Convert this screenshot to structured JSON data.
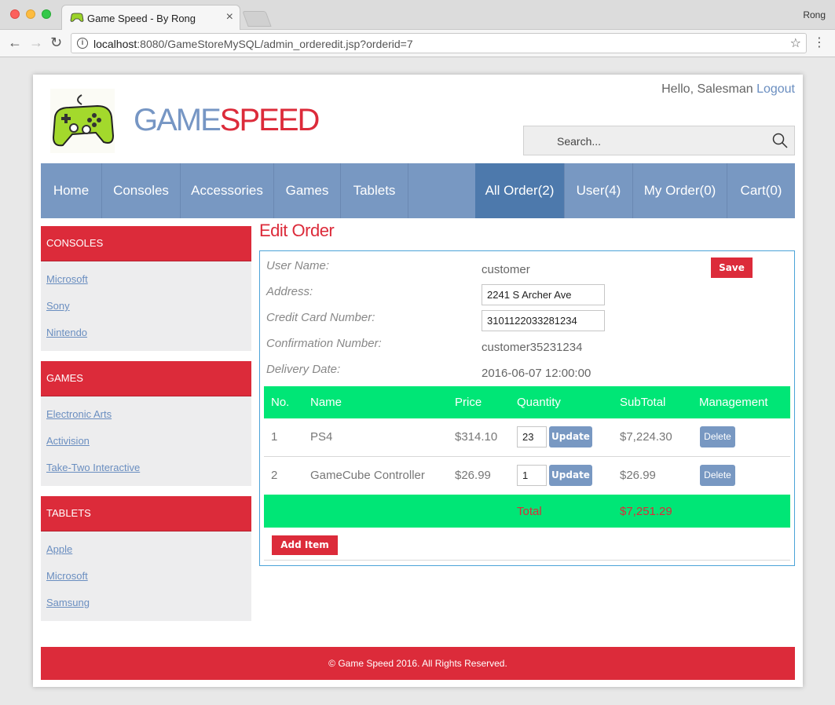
{
  "browser": {
    "tab_title": "Game Speed - By Rong",
    "profile": "Rong",
    "url_host": "localhost",
    "url_rest": ":8080/GameStoreMySQL/admin_orderedit.jsp?orderid=7"
  },
  "header": {
    "brand_game": "GAME",
    "brand_speed": "SPEED",
    "greeting": "Hello, Salesman",
    "logout": "Logout",
    "search_placeholder": "Search..."
  },
  "nav": {
    "items": [
      "Home",
      "Consoles",
      "Accessories",
      "Games",
      "Tablets"
    ],
    "right": [
      "All Order(2)",
      "User(4)",
      "My Order(0)",
      "Cart(0)"
    ],
    "active": "All Order(2)"
  },
  "sidebar": [
    {
      "title": "CONSOLES",
      "links": [
        "Microsoft",
        "Sony",
        "Nintendo"
      ]
    },
    {
      "title": "GAMES",
      "links": [
        "Electronic Arts",
        "Activision",
        "Take-Two Interactive"
      ]
    },
    {
      "title": "TABLETS",
      "links": [
        "Apple",
        "Microsoft",
        "Samsung"
      ]
    }
  ],
  "order": {
    "title": "Edit Order",
    "labels": {
      "user_name": "User Name:",
      "address": "Address:",
      "credit_card": "Credit Card Number:",
      "confirmation": "Confirmation Number:",
      "delivery": "Delivery Date:"
    },
    "values": {
      "user_name": "customer",
      "address": "2241 S Archer Ave",
      "credit_card": "3101122033281234",
      "confirmation": "customer35231234",
      "delivery": "2016-06-07 12:00:00"
    },
    "save_label": "Save",
    "columns": [
      "No.",
      "Name",
      "Price",
      "Quantity",
      "SubTotal",
      "Management"
    ],
    "rows": [
      {
        "no": "1",
        "name": "PS4",
        "price": "$314.10",
        "qty": "23",
        "subtotal": "$7,224.30"
      },
      {
        "no": "2",
        "name": "GameCube Controller",
        "price": "$26.99",
        "qty": "1",
        "subtotal": "$26.99"
      }
    ],
    "update_label": "Update",
    "delete_label": "Delete",
    "total_label": "Total",
    "total_value": "$7,251.29",
    "add_item_label": "Add Item"
  },
  "footer": {
    "text": "© Game Speed 2016. All Rights Reserved."
  }
}
